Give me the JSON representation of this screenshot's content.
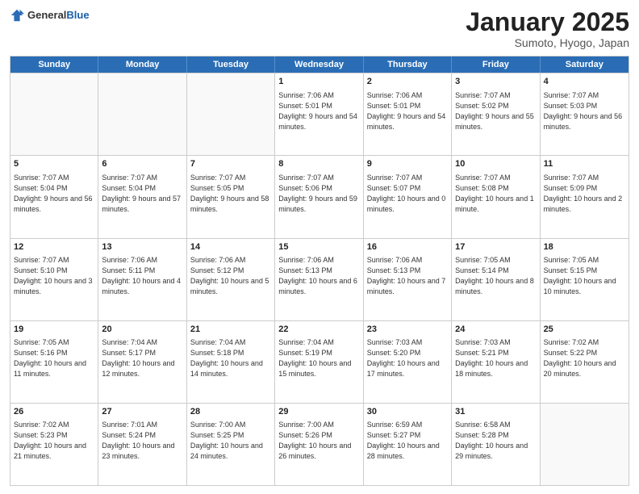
{
  "header": {
    "logo": {
      "general": "General",
      "blue": "Blue"
    },
    "title": "January 2025",
    "location": "Sumoto, Hyogo, Japan"
  },
  "days_of_week": [
    "Sunday",
    "Monday",
    "Tuesday",
    "Wednesday",
    "Thursday",
    "Friday",
    "Saturday"
  ],
  "weeks": [
    [
      {
        "day": "",
        "info": ""
      },
      {
        "day": "",
        "info": ""
      },
      {
        "day": "",
        "info": ""
      },
      {
        "day": "1",
        "info": "Sunrise: 7:06 AM\nSunset: 5:01 PM\nDaylight: 9 hours\nand 54 minutes."
      },
      {
        "day": "2",
        "info": "Sunrise: 7:06 AM\nSunset: 5:01 PM\nDaylight: 9 hours\nand 54 minutes."
      },
      {
        "day": "3",
        "info": "Sunrise: 7:07 AM\nSunset: 5:02 PM\nDaylight: 9 hours\nand 55 minutes."
      },
      {
        "day": "4",
        "info": "Sunrise: 7:07 AM\nSunset: 5:03 PM\nDaylight: 9 hours\nand 56 minutes."
      }
    ],
    [
      {
        "day": "5",
        "info": "Sunrise: 7:07 AM\nSunset: 5:04 PM\nDaylight: 9 hours\nand 56 minutes."
      },
      {
        "day": "6",
        "info": "Sunrise: 7:07 AM\nSunset: 5:04 PM\nDaylight: 9 hours\nand 57 minutes."
      },
      {
        "day": "7",
        "info": "Sunrise: 7:07 AM\nSunset: 5:05 PM\nDaylight: 9 hours\nand 58 minutes."
      },
      {
        "day": "8",
        "info": "Sunrise: 7:07 AM\nSunset: 5:06 PM\nDaylight: 9 hours\nand 59 minutes."
      },
      {
        "day": "9",
        "info": "Sunrise: 7:07 AM\nSunset: 5:07 PM\nDaylight: 10 hours\nand 0 minutes."
      },
      {
        "day": "10",
        "info": "Sunrise: 7:07 AM\nSunset: 5:08 PM\nDaylight: 10 hours\nand 1 minute."
      },
      {
        "day": "11",
        "info": "Sunrise: 7:07 AM\nSunset: 5:09 PM\nDaylight: 10 hours\nand 2 minutes."
      }
    ],
    [
      {
        "day": "12",
        "info": "Sunrise: 7:07 AM\nSunset: 5:10 PM\nDaylight: 10 hours\nand 3 minutes."
      },
      {
        "day": "13",
        "info": "Sunrise: 7:06 AM\nSunset: 5:11 PM\nDaylight: 10 hours\nand 4 minutes."
      },
      {
        "day": "14",
        "info": "Sunrise: 7:06 AM\nSunset: 5:12 PM\nDaylight: 10 hours\nand 5 minutes."
      },
      {
        "day": "15",
        "info": "Sunrise: 7:06 AM\nSunset: 5:13 PM\nDaylight: 10 hours\nand 6 minutes."
      },
      {
        "day": "16",
        "info": "Sunrise: 7:06 AM\nSunset: 5:13 PM\nDaylight: 10 hours\nand 7 minutes."
      },
      {
        "day": "17",
        "info": "Sunrise: 7:05 AM\nSunset: 5:14 PM\nDaylight: 10 hours\nand 8 minutes."
      },
      {
        "day": "18",
        "info": "Sunrise: 7:05 AM\nSunset: 5:15 PM\nDaylight: 10 hours\nand 10 minutes."
      }
    ],
    [
      {
        "day": "19",
        "info": "Sunrise: 7:05 AM\nSunset: 5:16 PM\nDaylight: 10 hours\nand 11 minutes."
      },
      {
        "day": "20",
        "info": "Sunrise: 7:04 AM\nSunset: 5:17 PM\nDaylight: 10 hours\nand 12 minutes."
      },
      {
        "day": "21",
        "info": "Sunrise: 7:04 AM\nSunset: 5:18 PM\nDaylight: 10 hours\nand 14 minutes."
      },
      {
        "day": "22",
        "info": "Sunrise: 7:04 AM\nSunset: 5:19 PM\nDaylight: 10 hours\nand 15 minutes."
      },
      {
        "day": "23",
        "info": "Sunrise: 7:03 AM\nSunset: 5:20 PM\nDaylight: 10 hours\nand 17 minutes."
      },
      {
        "day": "24",
        "info": "Sunrise: 7:03 AM\nSunset: 5:21 PM\nDaylight: 10 hours\nand 18 minutes."
      },
      {
        "day": "25",
        "info": "Sunrise: 7:02 AM\nSunset: 5:22 PM\nDaylight: 10 hours\nand 20 minutes."
      }
    ],
    [
      {
        "day": "26",
        "info": "Sunrise: 7:02 AM\nSunset: 5:23 PM\nDaylight: 10 hours\nand 21 minutes."
      },
      {
        "day": "27",
        "info": "Sunrise: 7:01 AM\nSunset: 5:24 PM\nDaylight: 10 hours\nand 23 minutes."
      },
      {
        "day": "28",
        "info": "Sunrise: 7:00 AM\nSunset: 5:25 PM\nDaylight: 10 hours\nand 24 minutes."
      },
      {
        "day": "29",
        "info": "Sunrise: 7:00 AM\nSunset: 5:26 PM\nDaylight: 10 hours\nand 26 minutes."
      },
      {
        "day": "30",
        "info": "Sunrise: 6:59 AM\nSunset: 5:27 PM\nDaylight: 10 hours\nand 28 minutes."
      },
      {
        "day": "31",
        "info": "Sunrise: 6:58 AM\nSunset: 5:28 PM\nDaylight: 10 hours\nand 29 minutes."
      },
      {
        "day": "",
        "info": ""
      }
    ]
  ]
}
